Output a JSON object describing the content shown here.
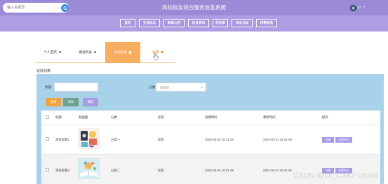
{
  "header": {
    "search_placeholder": "输入关键词",
    "title": "高校校友综合服务信息系统",
    "user_name": "zz",
    "colors": {
      "header_bg": "#9b8bd6",
      "nav_bg": "#ad9de3"
    }
  },
  "nav": {
    "items": [
      {
        "label": "首页"
      },
      {
        "label": "交流论坛"
      },
      {
        "label": "新闻公告"
      },
      {
        "label": "校友资讯"
      },
      {
        "label": "校友录"
      },
      {
        "label": "校友活动"
      },
      {
        "label": "招聘信息"
      }
    ]
  },
  "tabs": [
    {
      "label": "个人首页",
      "icon": "dot-icon"
    },
    {
      "label": "跟帖列表",
      "icon": "dot-icon"
    },
    {
      "label": "论坛列表",
      "icon": "dot-icon",
      "active": true
    },
    {
      "label": "收藏",
      "icon": "dot-icon"
    }
  ],
  "forum": {
    "section_title": "论坛列表",
    "filters": {
      "title_label": "标题",
      "title_value": "",
      "category_label": "分类",
      "category_placeholder": "请选择"
    },
    "buttons": {
      "search": "查询",
      "add": "添加",
      "delete": "删除"
    },
    "table": {
      "columns": [
        "标题",
        "封面图",
        "分类",
        "标签",
        "创建时间",
        "更新时间",
        "操作"
      ],
      "rows": [
        {
          "title": "测试标题1",
          "category": "分类一",
          "tag": "标签",
          "created": "2024-03-31 16:21:49",
          "updated": "2024-03-31 16:21:49",
          "actions": [
            "详情",
            "查看评论"
          ]
        },
        {
          "title": "测试标题2",
          "category": "分类二",
          "tag": "标签",
          "created": "2024-03-31 16:21:49",
          "updated": "2024-03-31 16:21:49",
          "actions": [
            "详情",
            "查看评论"
          ]
        }
      ]
    }
  },
  "watermark": "CSDN @vx_CXKF10088"
}
